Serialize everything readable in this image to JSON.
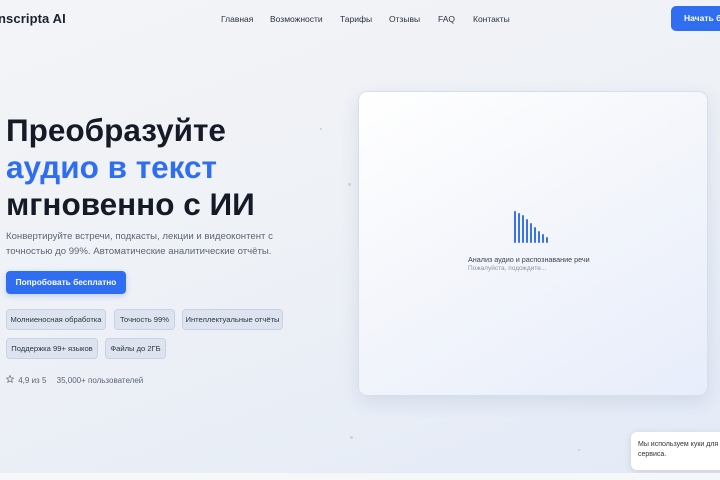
{
  "header": {
    "logo": "nscripta AI",
    "nav": [
      "Главная",
      "Возможности",
      "Тарифы",
      "Отзывы",
      "FAQ",
      "Контакты"
    ],
    "cta": "Начать бе"
  },
  "hero": {
    "title_line1": "Преобразуйте",
    "title_line2": "аудио в текст",
    "title_line3": "мгновенно с ИИ",
    "description": "Конвертируйте встречи, подкасты, лекции и видеоконтент с точностью до 99%. Автоматические аналитические отчёты.",
    "cta": "Попробовать бесплатно",
    "chips": [
      "Молниеносная обработка",
      "Точность 99%",
      "Интеллектуальные отчёты",
      "Поддержка 99+ языков",
      "Файлы до 2ГБ"
    ],
    "rating": "4,9 из 5",
    "users": "35,000+ пользователей"
  },
  "card": {
    "title": "Анализ аудио и распознавание речи",
    "subtitle": "Пожалуйста, подождите..."
  },
  "cookie": {
    "line1": "Мы используем куки для т",
    "line2": "сервиса."
  },
  "colors": {
    "accent": "#2f6ef0",
    "text": "#151b26",
    "muted": "#5d6675"
  },
  "icons": {
    "rating": "star-outline-icon",
    "loader": "waveform-icon"
  }
}
